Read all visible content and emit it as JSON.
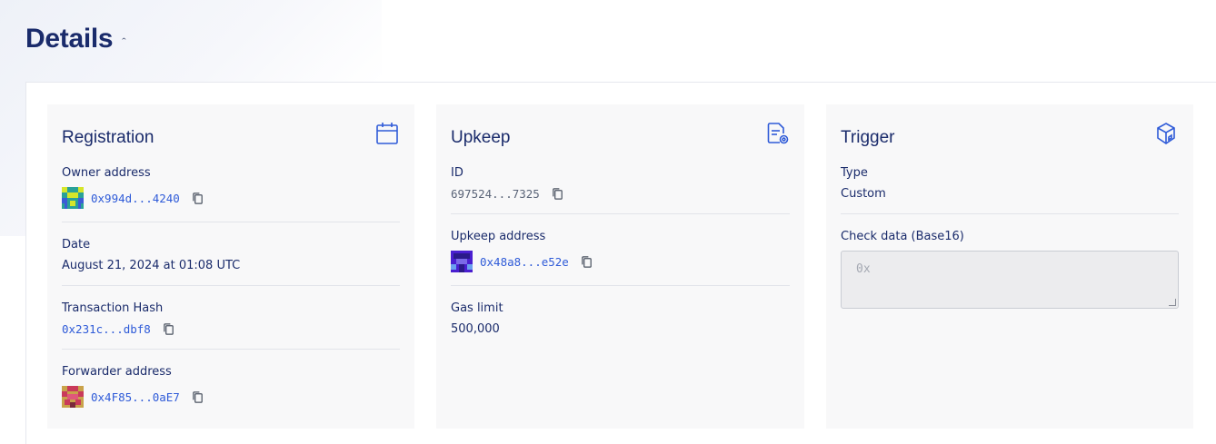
{
  "header": {
    "title": "Details",
    "caret": "ˆ"
  },
  "registration": {
    "title": "Registration",
    "icon": "calendar-icon",
    "owner_address_label": "Owner address",
    "owner_address": "0x994d...4240",
    "date_label": "Date",
    "date": "August 21, 2024 at 01:08 UTC",
    "tx_hash_label": "Transaction Hash",
    "tx_hash": "0x231c...dbf8",
    "forwarder_label": "Forwarder address",
    "forwarder": "0x4F85...0aE7"
  },
  "upkeep": {
    "title": "Upkeep",
    "icon": "document-settings-icon",
    "id_label": "ID",
    "id": "697524...7325",
    "address_label": "Upkeep address",
    "address": "0x48a8...e52e",
    "gas_label": "Gas limit",
    "gas": "500,000"
  },
  "trigger": {
    "title": "Trigger",
    "icon": "cube-icon",
    "type_label": "Type",
    "type": "Custom",
    "check_data_label": "Check data (Base16)",
    "check_data_placeholder": "0x"
  },
  "colors": {
    "accent": "#2f5bd8",
    "title": "#1a2b6b",
    "card_bg": "#f8f8f9"
  }
}
